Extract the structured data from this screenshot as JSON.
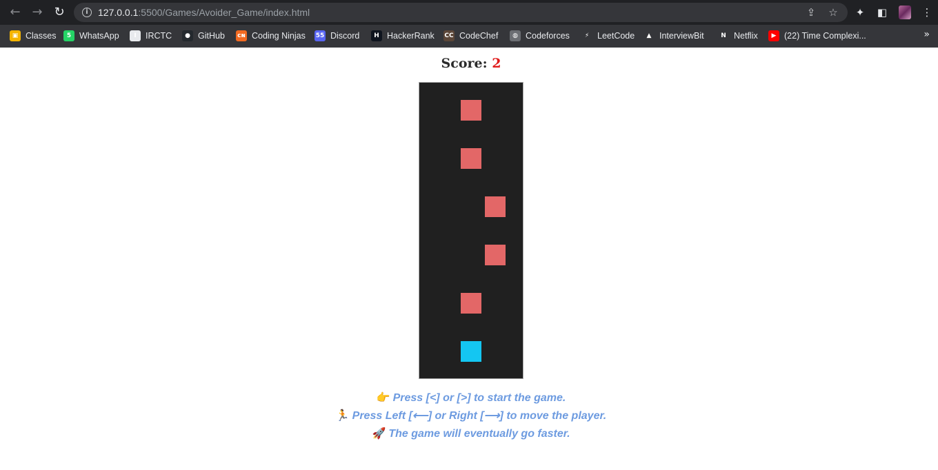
{
  "browser": {
    "url_host": "127.0.0.1",
    "url_path": ":5500/Games/Avoider_Game/index.html"
  },
  "bookmarks": [
    {
      "label": "Classes",
      "icon": "google-classroom-icon",
      "color": "#f4b400",
      "glyph": "▣"
    },
    {
      "label": "WhatsApp",
      "icon": "whatsapp-icon",
      "color": "#25d366",
      "glyph": "5"
    },
    {
      "label": "IRCTC",
      "icon": "irctc-icon",
      "color": "#e8eaed",
      "glyph": "I"
    },
    {
      "label": "GitHub",
      "icon": "github-icon",
      "color": "#24292e",
      "glyph": "●"
    },
    {
      "label": "Coding Ninjas",
      "icon": "coding-ninjas-icon",
      "color": "#f26a21",
      "glyph": "ᴄɴ"
    },
    {
      "label": "Discord",
      "icon": "discord-icon",
      "color": "#5865f2",
      "glyph": "55"
    },
    {
      "label": "HackerRank",
      "icon": "hackerrank-icon",
      "color": "#0e141e",
      "glyph": "H"
    },
    {
      "label": "CodeChef",
      "icon": "codechef-icon",
      "color": "#5b4638",
      "glyph": "CC"
    },
    {
      "label": "Codeforces",
      "icon": "codeforces-icon",
      "color": "#6b6e73",
      "glyph": "◍"
    },
    {
      "label": "LeetCode",
      "icon": "leetcode-icon",
      "color": "#35363a",
      "glyph": "⚡"
    },
    {
      "label": "InterviewBit",
      "icon": "interviewbit-icon",
      "color": "#35363a",
      "glyph": "▲"
    },
    {
      "label": "Netflix",
      "icon": "netflix-icon",
      "color": "#35363a",
      "glyph": "N"
    },
    {
      "label": "(22) Time Complexi...",
      "icon": "youtube-icon",
      "color": "#ff0000",
      "glyph": "▶"
    }
  ],
  "bookmark_more": "»",
  "game": {
    "score_label": "Score:",
    "score_value": "2",
    "board_color": "#202020",
    "enemy_color": "#e36767",
    "player_color": "#14c6f2",
    "enemies": [
      {
        "lane": 1,
        "row": 0
      },
      {
        "lane": 1,
        "row": 1
      },
      {
        "lane": 2,
        "row": 2
      },
      {
        "lane": 2,
        "row": 3
      },
      {
        "lane": 1,
        "row": 4
      }
    ],
    "player": {
      "lane": 1,
      "row": 5
    }
  },
  "instructions": [
    {
      "emoji": "👉",
      "emoji_name": "pointing-hand-icon",
      "text": "Press [<] or [>] to start the game."
    },
    {
      "emoji": "🏃",
      "emoji_name": "running-person-icon",
      "text": "Press Left [⟵] or Right [⟶] to move the player."
    },
    {
      "emoji": "🚀",
      "emoji_name": "rocket-icon",
      "text": "The game will eventually go faster."
    }
  ]
}
